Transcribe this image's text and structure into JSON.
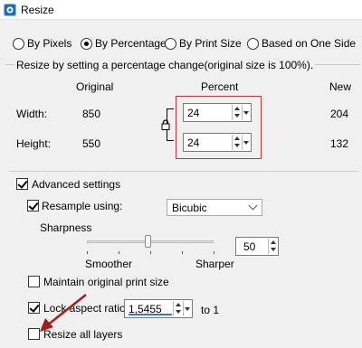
{
  "window": {
    "title": "Resize",
    "icon": "app-logo-icon"
  },
  "resize_mode": {
    "options": [
      "By Pixels",
      "By Percentage",
      "By Print Size",
      "Based on One Side"
    ],
    "selected": "By Percentage"
  },
  "percentage_group": {
    "title": "Resize by setting a percentage change(original size is 100%).",
    "headers": {
      "original": "Original",
      "percent": "Percent",
      "new": "New"
    },
    "width": {
      "label": "Width:",
      "original": "850",
      "percent": "24",
      "new": "204"
    },
    "height": {
      "label": "Height:",
      "original": "550",
      "percent": "24",
      "new": "132"
    },
    "link_icon": "lock-icon",
    "highlight_color": "#b33a3a"
  },
  "advanced": {
    "label": "Advanced settings",
    "checked": true,
    "resample": {
      "label": "Resample using:",
      "checked": true,
      "method": "Bicubic"
    },
    "sharpness": {
      "label": "Sharpness",
      "min_label": "Smoother",
      "max_label": "Sharper",
      "value": "50",
      "level": 0.5
    },
    "maintain_print": {
      "label": "Maintain original print size",
      "checked": false
    },
    "lock_aspect": {
      "label": "Lock aspect ratio:",
      "checked": true,
      "value": "1,5455",
      "suffix": "to 1"
    },
    "resize_layers": {
      "label": "Resize all layers",
      "checked": false
    }
  },
  "annotation": {
    "arrow_color": "#a02020",
    "icon": "pointer-arrow-icon"
  }
}
